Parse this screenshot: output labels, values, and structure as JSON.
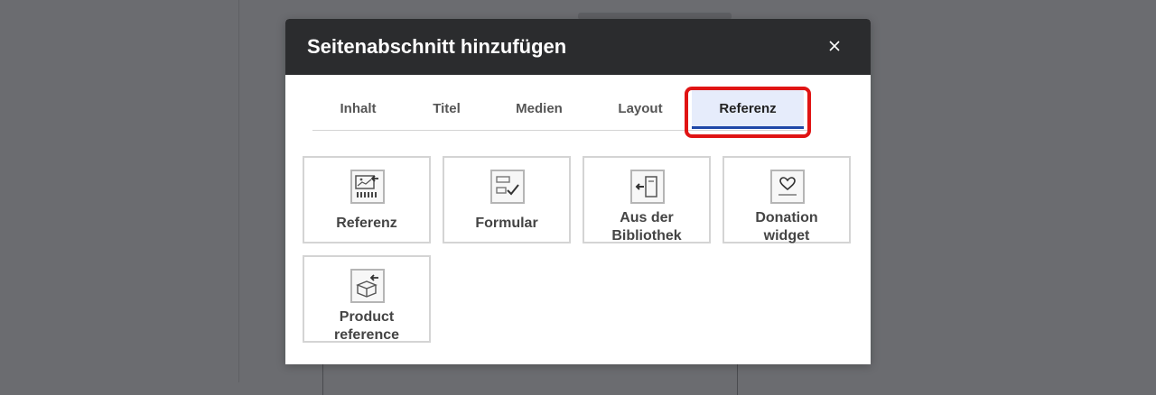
{
  "dialog": {
    "title": "Seitenabschnitt hinzufügen",
    "close_label": "×"
  },
  "tabs": [
    {
      "label": "Inhalt",
      "active": false
    },
    {
      "label": "Titel",
      "active": false
    },
    {
      "label": "Medien",
      "active": false
    },
    {
      "label": "Layout",
      "active": false
    },
    {
      "label": "Referenz",
      "active": true
    }
  ],
  "cards": [
    {
      "label": "Referenz",
      "icon": "reference-icon"
    },
    {
      "label": "Formular",
      "icon": "form-icon"
    },
    {
      "label_line1": "Aus der",
      "label_line2": "Bibliothek",
      "icon": "library-icon"
    },
    {
      "label_line1": "Donation",
      "label_line2": "widget",
      "icon": "donation-icon"
    },
    {
      "label_line1": "Product",
      "label_line2": "reference",
      "icon": "product-reference-icon"
    }
  ],
  "colors": {
    "header_bg": "#2b2c2e",
    "tab_active_bg": "#e6ecfb",
    "tab_active_underline": "#1f48a8",
    "highlight": "#e01414",
    "overlay": "#6b6c70"
  }
}
